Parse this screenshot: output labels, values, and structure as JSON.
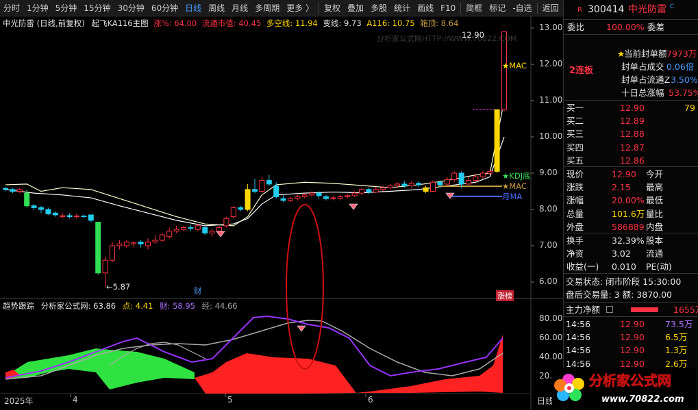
{
  "toolbar": {
    "items": [
      "分时",
      "1分钟",
      "5分钟",
      "15分钟",
      "30分钟",
      "60分钟",
      "日线",
      "周线",
      "月线",
      "多周期",
      "更多 〉",
      "复权",
      "叠加",
      "多股",
      "统计",
      "画线",
      "F10",
      "简框",
      "标记",
      "-自选",
      "返回"
    ],
    "active_index": 6
  },
  "chart": {
    "title": "中光防雷 (日线,前复权)",
    "indicator_name": "起飞KA116主图",
    "zhang_label": "涨%: 64.00",
    "liutong_label": "流通市值: 40.45",
    "duokong_label": "多空线: 11.94",
    "bianxian_label": "变线: 9.73",
    "a116_label": "A116: 10.75",
    "xiangding_label": "箱顶: 8.64",
    "watermark": "分析家公式网HTTP://WWW.70822.COM",
    "peak_label": "12.90",
    "low_label": "←5.87",
    "mac_label": "★MAC",
    "kdj_label": "★KDJ底",
    "mac2_label": "★MAC",
    "month_label": "月MA",
    "cai_label": "财",
    "zhangbang_label": "涨榜",
    "price_ticks": [
      "13.00",
      "12.00",
      "11.00",
      "10.00",
      "9.00",
      "8.00",
      "7.00",
      "6.00"
    ],
    "sub_title": "趋势跟踪",
    "sub_source": "分析家公式网: 63.86",
    "sub_dian": "点: 4.41",
    "sub_cai": "财: 58.95",
    "sub_jing": "经: 44.66",
    "sub_ticks": [
      "80.00",
      "60.00",
      "40.00",
      "20.00"
    ],
    "x_labels": [
      "2025年",
      "4",
      "5",
      "6"
    ],
    "period_label": "日线"
  },
  "quote": {
    "code": "300414",
    "name": "中光防雷",
    "weibi_label": "委比",
    "weibi_value": "100.00%",
    "weicha_label": "委差",
    "lianban": "2连板",
    "fengdan_label": "当前封单额",
    "fengdan_value": "7973万",
    "fengdan_cj_label": "封单占成交",
    "fengdan_cj_value": "0.06倍",
    "fengdan_lt_label": "封单占流通Z",
    "fengdan_lt_value": "3.50%",
    "shiri_label": "十日总涨幅",
    "shiri_value": "53.75%",
    "buy": [
      {
        "label": "买一",
        "price": "12.90",
        "vol": "79"
      },
      {
        "label": "买二",
        "price": "12.89",
        "vol": ""
      },
      {
        "label": "买三",
        "price": "12.88",
        "vol": ""
      },
      {
        "label": "买四",
        "price": "12.87",
        "vol": ""
      },
      {
        "label": "买五",
        "price": "12.86",
        "vol": ""
      }
    ],
    "stats": [
      {
        "l1": "现价",
        "v1": "12.90",
        "l2": "今开"
      },
      {
        "l1": "涨跌",
        "v1": "2.15",
        "l2": "最高"
      },
      {
        "l1": "涨幅",
        "v1": "20.00%",
        "l2": "最低"
      },
      {
        "l1": "总量",
        "v1": "101.6万",
        "l2": "量比"
      },
      {
        "l1": "外盘",
        "v1": "586889",
        "l2": "内盘"
      }
    ],
    "stats2": [
      {
        "l1": "换手",
        "v1": "32.39%",
        "l2": "股本"
      },
      {
        "l1": "净资",
        "v1": "3.02",
        "l2": "流通"
      },
      {
        "l1": "收益(一)",
        "v1": "0.010",
        "l2": "PE(动)"
      }
    ],
    "trade_status": "交易状态: 闭市阶段 15:30:00",
    "after_hours": "盘后交易量: 3  额: 3870.00",
    "main_net_label": "主力净额",
    "main_net_value": "1655万",
    "ticks": [
      {
        "time": "14:56",
        "price": "12.90",
        "vol": "73.5万"
      },
      {
        "time": "14:56",
        "price": "12.90",
        "vol": "6.5万"
      },
      {
        "time": "14:56",
        "price": "12.90",
        "vol": "1.3万"
      },
      {
        "time": "14:56",
        "price": "12.90",
        "vol": "2.6万"
      }
    ]
  },
  "logo": {
    "text": "分析家公式网",
    "url_text": "www.70822.com"
  },
  "colors": {
    "up": "#ff3344",
    "down": "#22ccee",
    "accent": "#4a9cff",
    "yellow": "#ffd700"
  }
}
